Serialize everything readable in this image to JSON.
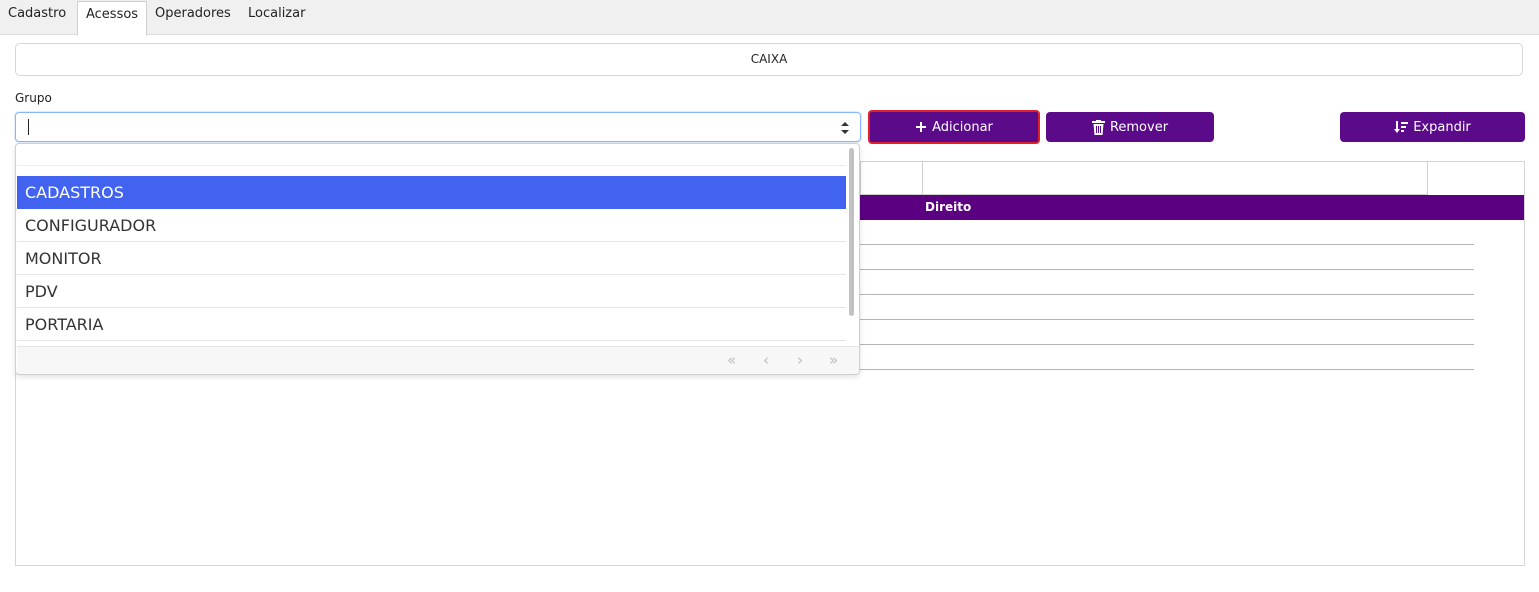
{
  "tabs": [
    {
      "label": "Cadastro"
    },
    {
      "label": "Acessos",
      "active": true
    },
    {
      "label": "Operadores"
    },
    {
      "label": "Localizar"
    }
  ],
  "header": {
    "title": "CAIXA"
  },
  "form": {
    "grupo_label": "Grupo",
    "grupo_value": ""
  },
  "buttons": {
    "add_label": "Adicionar",
    "remove_label": "Remover",
    "expand_label": "Expandir"
  },
  "grid": {
    "columns": [
      "Direito"
    ]
  },
  "dropdown": {
    "options": [
      "CADASTROS",
      "CONFIGURADOR",
      "MONITOR",
      "PDV",
      "PORTARIA"
    ],
    "selected_index": 0,
    "pager": [
      "«",
      "‹",
      "›",
      "»"
    ]
  },
  "colors": {
    "primary": "#5b0a8a",
    "selection": "#4263f0",
    "highlight_border": "#e0202a"
  }
}
